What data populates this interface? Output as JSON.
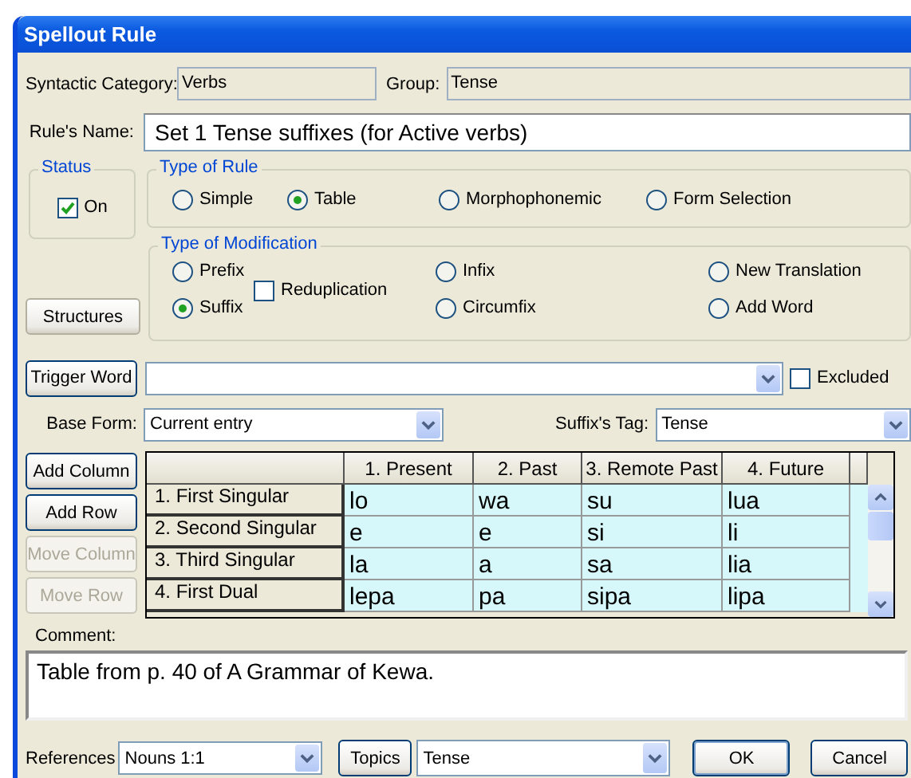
{
  "window": {
    "title": "Spellout Rule"
  },
  "syntactic_category": {
    "label": "Syntactic Category:",
    "value": "Verbs"
  },
  "group": {
    "label": "Group:",
    "value": "Tense"
  },
  "rule_name": {
    "label": "Rule's Name:",
    "value": "Set 1 Tense suffixes (for Active verbs)"
  },
  "status": {
    "title": "Status",
    "label": "On",
    "checked": true
  },
  "type_of_rule": {
    "title": "Type of Rule",
    "options": [
      {
        "label": "Simple",
        "selected": false
      },
      {
        "label": "Table",
        "selected": true
      },
      {
        "label": "Morphophonemic",
        "selected": false
      },
      {
        "label": "Form Selection",
        "selected": false
      }
    ]
  },
  "type_of_modification": {
    "title": "Type of Modification",
    "columns": [
      {
        "items": [
          {
            "kind": "radio",
            "label": "Prefix",
            "selected": false
          },
          {
            "kind": "radio",
            "label": "Suffix",
            "selected": true
          }
        ]
      },
      {
        "items": [
          {
            "kind": "checkbox",
            "label": "Reduplication",
            "checked": false
          }
        ]
      },
      {
        "items": [
          {
            "kind": "radio",
            "label": "Infix",
            "selected": false
          },
          {
            "kind": "radio",
            "label": "Circumfix",
            "selected": false
          }
        ]
      },
      {
        "items": [
          {
            "kind": "radio",
            "label": "New Translation",
            "selected": false
          },
          {
            "kind": "radio",
            "label": "Add Word",
            "selected": false
          }
        ]
      }
    ]
  },
  "structures_button": "Structures",
  "trigger_word": {
    "button": "Trigger Word"
  },
  "excluded": {
    "label": "Excluded",
    "checked": false
  },
  "base_form": {
    "label": "Base Form:",
    "value": "Current entry"
  },
  "suffix_tag": {
    "label": "Suffix's Tag:",
    "value": "Tense"
  },
  "table_buttons": [
    {
      "label": "Add Column",
      "disabled": false
    },
    {
      "label": "Add Row",
      "disabled": false
    },
    {
      "label": "Move Column",
      "disabled": true
    },
    {
      "label": "Move Row",
      "disabled": true
    }
  ],
  "table": {
    "columns": [
      "1. Present",
      "2. Past",
      "3. Remote Past",
      "4. Future"
    ],
    "rows": [
      {
        "header": "1. First Singular",
        "cells": [
          "lo",
          "wa",
          "su",
          "lua"
        ]
      },
      {
        "header": "2. Second Singular",
        "cells": [
          "e",
          "e",
          "si",
          "li"
        ]
      },
      {
        "header": "3. Third Singular",
        "cells": [
          "la",
          "a",
          "sa",
          "lia"
        ]
      },
      {
        "header": "4. First Dual",
        "cells": [
          "lepa",
          "pa",
          "sipa",
          "lipa"
        ]
      }
    ]
  },
  "comment": {
    "label": "Comment:",
    "value": "Table from p. 40 of A Grammar of Kewa."
  },
  "references": {
    "label": "References",
    "value": "Nouns 1:1"
  },
  "topics": {
    "button": "Topics",
    "value": "Tense"
  },
  "buttons": [
    "OK",
    "Cancel"
  ]
}
